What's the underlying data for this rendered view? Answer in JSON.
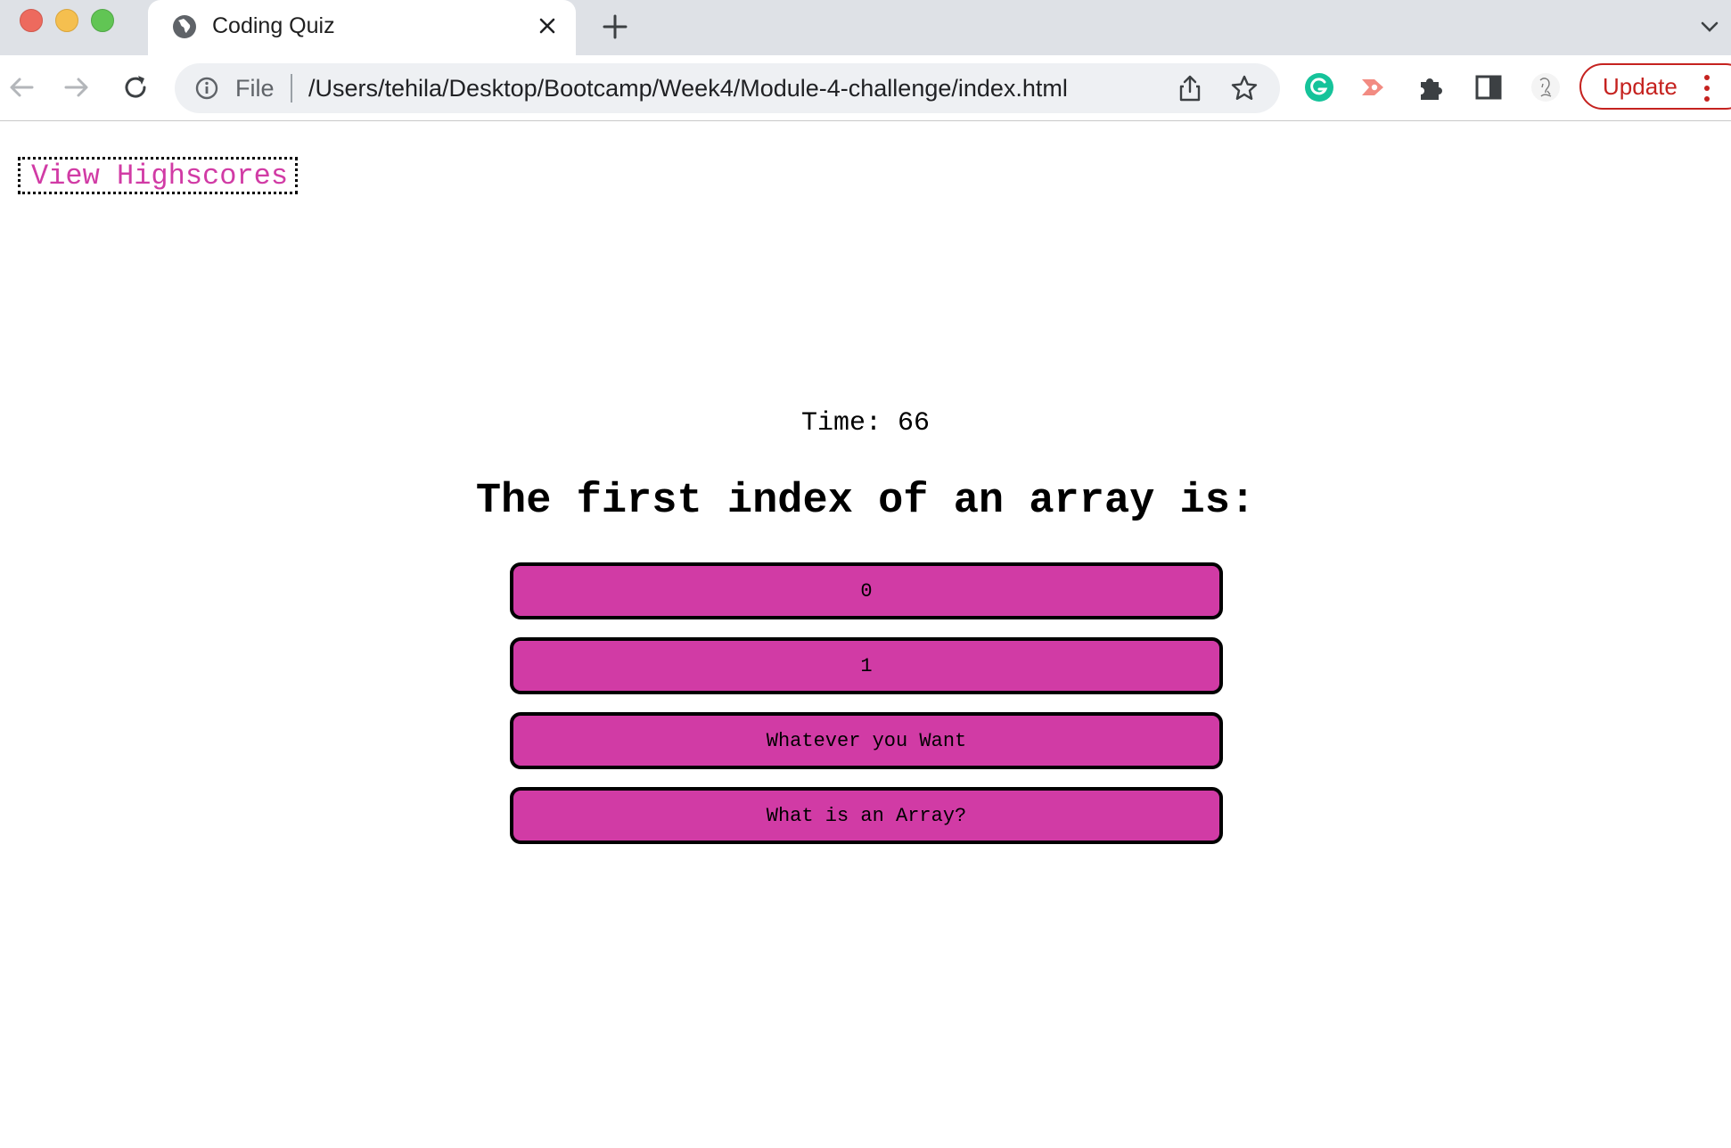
{
  "browser": {
    "tab_title": "Coding Quiz",
    "address_prefix": "File",
    "url": "/Users/tehila/Desktop/Bootcamp/Week4/Module-4-challenge/index.html",
    "update_label": "Update",
    "icons": [
      "globe-icon",
      "close-icon",
      "plus-icon",
      "chevron-down-icon",
      "back-arrow-icon",
      "forward-arrow-icon",
      "reload-icon",
      "info-icon",
      "share-icon",
      "star-icon",
      "grammarly-icon",
      "screencast-icon",
      "puzzle-icon",
      "side-panel-icon",
      "profile-avatar",
      "more-vert-icon"
    ]
  },
  "page": {
    "highscores_link": "View Highscores",
    "timer_label": "Time:",
    "timer_value": "66",
    "question": "The first index of an array is:",
    "answers": [
      "0",
      "1",
      "Whatever you Want",
      "What is an Array?"
    ]
  },
  "colors": {
    "accent_pink": "#d13ba5",
    "update_red": "#c5221f",
    "grammarly_green": "#15c39a"
  }
}
